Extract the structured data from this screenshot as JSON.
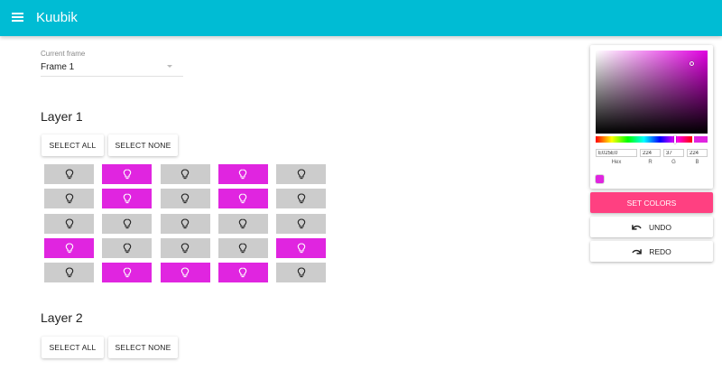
{
  "appbar": {
    "title": "Kuubik",
    "menu_icon": "menu-icon",
    "color": "#00bcd4"
  },
  "frame": {
    "label": "Current frame",
    "value": "Frame 1"
  },
  "layers": [
    {
      "title": "Layer 1",
      "select_all": "Select all",
      "select_none": "Select none",
      "cells": [
        [
          false,
          true,
          false,
          true,
          false
        ],
        [
          false,
          true,
          false,
          true,
          false
        ],
        [
          false,
          false,
          false,
          false,
          false
        ],
        [
          true,
          false,
          false,
          false,
          true
        ],
        [
          false,
          true,
          true,
          true,
          false
        ]
      ]
    },
    {
      "title": "Layer 2",
      "select_all": "Select all",
      "select_none": "Select none"
    }
  ],
  "cell_icon": "lightbulb-icon",
  "colors": {
    "on": "#e025e0",
    "off": "#cccccc",
    "accent": "#ff4081"
  },
  "picker": {
    "hex": "E025E0",
    "r": "224",
    "g": "37",
    "b": "224",
    "labels": {
      "hex": "Hex",
      "r": "R",
      "g": "G",
      "b": "B"
    },
    "preset_colors": [
      "#e025e0"
    ]
  },
  "actions": {
    "set_colors": "Set colors",
    "undo": "Undo",
    "redo": "Redo"
  }
}
